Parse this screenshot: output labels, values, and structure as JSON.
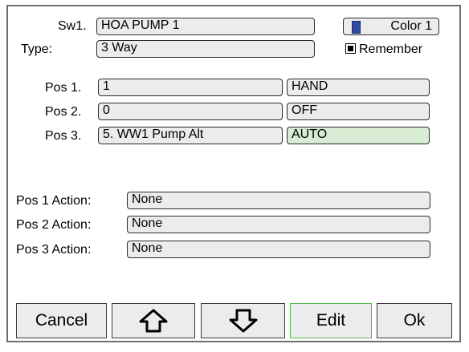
{
  "switch": {
    "label": "Sw1.",
    "name": "HOA PUMP 1"
  },
  "type": {
    "label": "Type:",
    "value": "3 Way"
  },
  "color": {
    "label": "Color 1",
    "swatch": "#2f4ca4"
  },
  "remember": {
    "label": "Remember",
    "checked": true
  },
  "positions": [
    {
      "label": "Pos 1.",
      "value": "1",
      "state": "HAND"
    },
    {
      "label": "Pos 2.",
      "value": "0",
      "state": "OFF"
    },
    {
      "label": "Pos 3.",
      "value": "5. WW1 Pump Alt",
      "state": "AUTO",
      "active": true
    }
  ],
  "actions": [
    {
      "label": "Pos 1 Action:",
      "value": "None"
    },
    {
      "label": "Pos 2 Action:",
      "value": "None"
    },
    {
      "label": "Pos 3 Action:",
      "value": "None"
    }
  ],
  "buttons": {
    "cancel": "Cancel",
    "up_icon": "arrow-up-icon",
    "down_icon": "arrow-down-icon",
    "edit": "Edit",
    "ok": "Ok"
  },
  "colors": {
    "active_state": "#d8ecd3",
    "edit_border": "#58b84c",
    "field_bg": "#ececec"
  }
}
